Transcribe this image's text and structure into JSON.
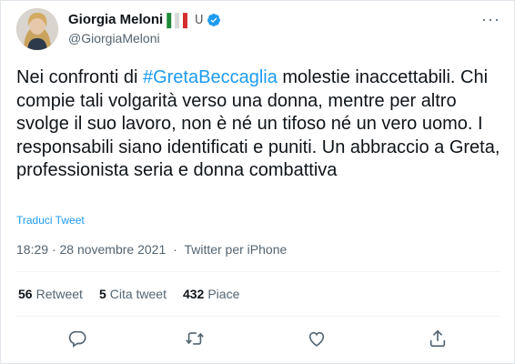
{
  "author": {
    "name": "Giorgia Meloni",
    "handle": "@GiorgiaMeloni",
    "verified": true,
    "avatar_icon": "profile-photo",
    "badges": [
      "italian-flag-icon",
      "horseshoe-icon"
    ]
  },
  "tweet": {
    "text_before": "Nei confronti di ",
    "hashtag": "#GretaBeccaglia",
    "text_after": " molestie inaccettabili. Chi compie tali volgarità verso una donna, mentre per altro svolge il suo lavoro, non è né un tifoso né un vero uomo. I responsabili siano identificati e puniti. Un abbraccio a Greta, professionista seria e donna combattiva",
    "translate_label": "Traduci Tweet",
    "timestamp": "18:29 · 28 novembre 2021",
    "separator": "·",
    "source": "Twitter per iPhone"
  },
  "stats": {
    "retweets_count": "56",
    "retweets_label": "Retweet",
    "quotes_count": "5",
    "quotes_label": "Cita tweet",
    "likes_count": "432",
    "likes_label": "Piace"
  },
  "actions": [
    "reply-icon",
    "retweet-icon",
    "like-icon",
    "share-icon"
  ],
  "colors": {
    "link": "#1d9bf0",
    "text": "#0f1419",
    "muted": "#536471",
    "verified": "#1d9bf0"
  }
}
